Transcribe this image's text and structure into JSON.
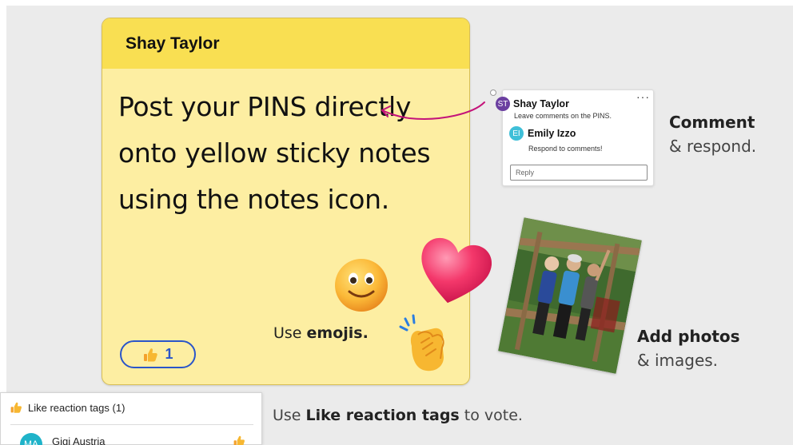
{
  "sticky_note": {
    "author": "Shay Taylor",
    "body": "Post your PINS directly onto yellow sticky notes using the notes icon.",
    "emoji_text_prefix": "Use ",
    "emoji_text_bold": "emojis.",
    "like_count": "1"
  },
  "comment_thread": {
    "more_label": "···",
    "comments": [
      {
        "initials": "ST",
        "name": "Shay Taylor",
        "text": "Leave comments on the PINS.",
        "color": "#6b3fa0"
      },
      {
        "initials": "EI",
        "name": "Emily Izzo",
        "text": "Respond to comments!",
        "color": "#3fbfd8"
      }
    ],
    "reply_placeholder": "Reply"
  },
  "callouts": {
    "comment_bold": "Comment",
    "comment_rest": "& respond.",
    "photos_bold": "Add photos",
    "photos_rest": "& images.",
    "vote_prefix": "Use ",
    "vote_bold": "Like reaction tags",
    "vote_suffix": " to vote."
  },
  "like_panel": {
    "title": "Like reaction tags (1)",
    "users": [
      {
        "initials": "MA",
        "name": "Gigi Austria",
        "color": "#1fb3c9"
      }
    ]
  },
  "colors": {
    "note_header": "#f9df52",
    "note_body": "#fdeea2",
    "like_blue": "#2a55c9",
    "arrow_magenta": "#c4147a"
  }
}
